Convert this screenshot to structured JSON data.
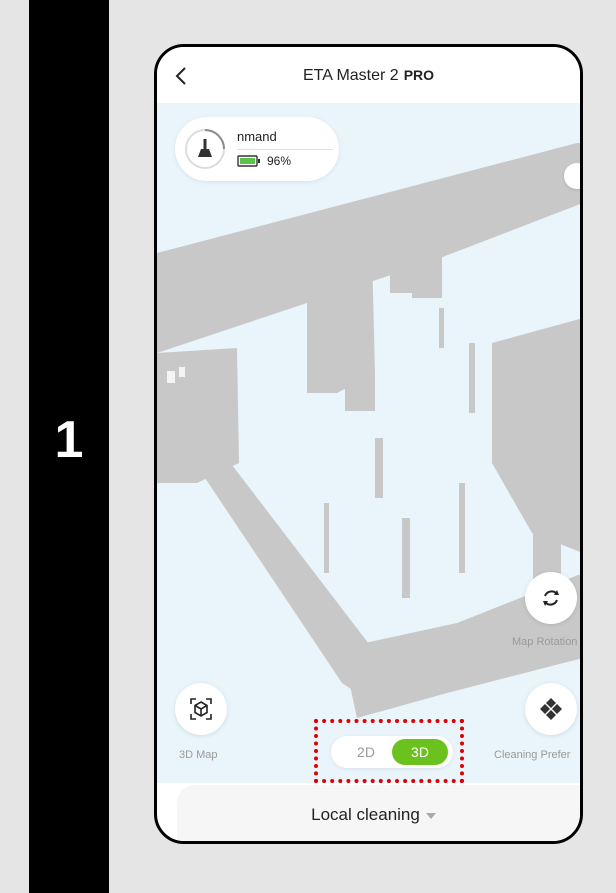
{
  "step": {
    "number": "1"
  },
  "header": {
    "title": "ETA Master 2",
    "title_suffix": "PRO"
  },
  "status": {
    "label": "nmand",
    "battery": "96%"
  },
  "buttons": {
    "map_rotation": "Map Rotation",
    "map_3d": "3D Map",
    "cleaning_pref": "Cleaning Prefer"
  },
  "view_toggle": {
    "option_2d": "2D",
    "option_3d": "3D",
    "selected": "3D"
  },
  "bottom": {
    "mode": "Local cleaning"
  },
  "colors": {
    "accent": "#6bc11d",
    "highlight": "#e00000",
    "map_bg": "#e9f4fb",
    "walls": "#c8c8c8"
  }
}
